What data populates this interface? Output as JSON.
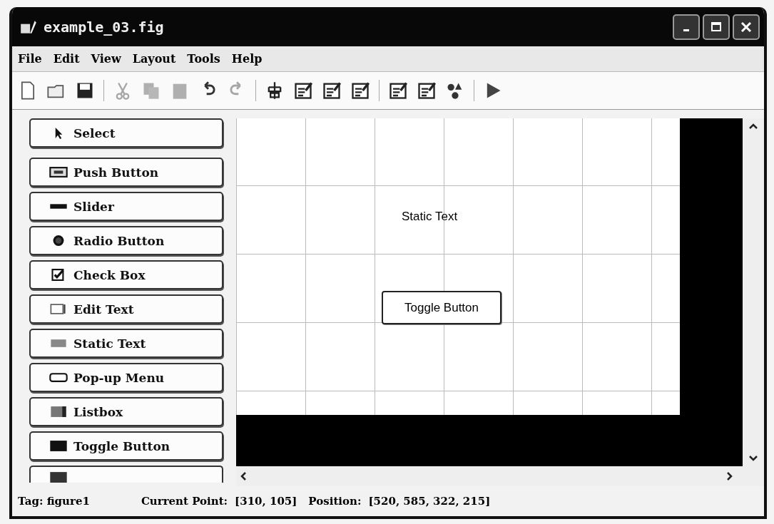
{
  "window": {
    "title": "example_03.fig"
  },
  "menu": [
    "File",
    "Edit",
    "View",
    "Layout",
    "Tools",
    "Help"
  ],
  "toolbar": [
    {
      "kind": "new",
      "disabled": false
    },
    {
      "kind": "open",
      "disabled": false
    },
    {
      "kind": "save",
      "disabled": false
    },
    {
      "kind": "sep"
    },
    {
      "kind": "cut",
      "disabled": true
    },
    {
      "kind": "copy",
      "disabled": true
    },
    {
      "kind": "paste",
      "disabled": true
    },
    {
      "kind": "undo",
      "disabled": false
    },
    {
      "kind": "redo",
      "disabled": true
    },
    {
      "kind": "sep"
    },
    {
      "kind": "align",
      "disabled": false
    },
    {
      "kind": "menueditor",
      "disabled": false
    },
    {
      "kind": "taborder",
      "disabled": false
    },
    {
      "kind": "toolbareditor",
      "disabled": false
    },
    {
      "kind": "sep"
    },
    {
      "kind": "editor",
      "disabled": false
    },
    {
      "kind": "inspector",
      "disabled": false
    },
    {
      "kind": "browser",
      "disabled": false
    },
    {
      "kind": "sep"
    },
    {
      "kind": "run",
      "disabled": false
    }
  ],
  "palette": [
    {
      "label": "Select",
      "kind": "arrow",
      "selected": false
    },
    {
      "label": "Push Button",
      "kind": "push",
      "selected": false
    },
    {
      "label": "Slider",
      "kind": "slider",
      "selected": false
    },
    {
      "label": "Radio Button",
      "kind": "radio",
      "selected": false
    },
    {
      "label": "Check Box",
      "kind": "check",
      "selected": false
    },
    {
      "label": "Edit Text",
      "kind": "edit",
      "selected": false
    },
    {
      "label": "Static Text",
      "kind": "static",
      "selected": false
    },
    {
      "label": "Pop-up Menu",
      "kind": "popup",
      "selected": false
    },
    {
      "label": "Listbox",
      "kind": "listbox",
      "selected": false
    },
    {
      "label": "Toggle Button",
      "kind": "toggle",
      "selected": false
    }
  ],
  "canvas": {
    "components": [
      {
        "kind": "static_text",
        "label": "Static Text"
      },
      {
        "kind": "toggle_button",
        "label": "Toggle Button"
      }
    ]
  },
  "status_bar": {
    "tag": "Tag: figure1",
    "current_point_label": "Current Point:",
    "current_point": "[310, 105]",
    "position_label": "Position:",
    "position": "[520, 585, 322, 215]"
  }
}
